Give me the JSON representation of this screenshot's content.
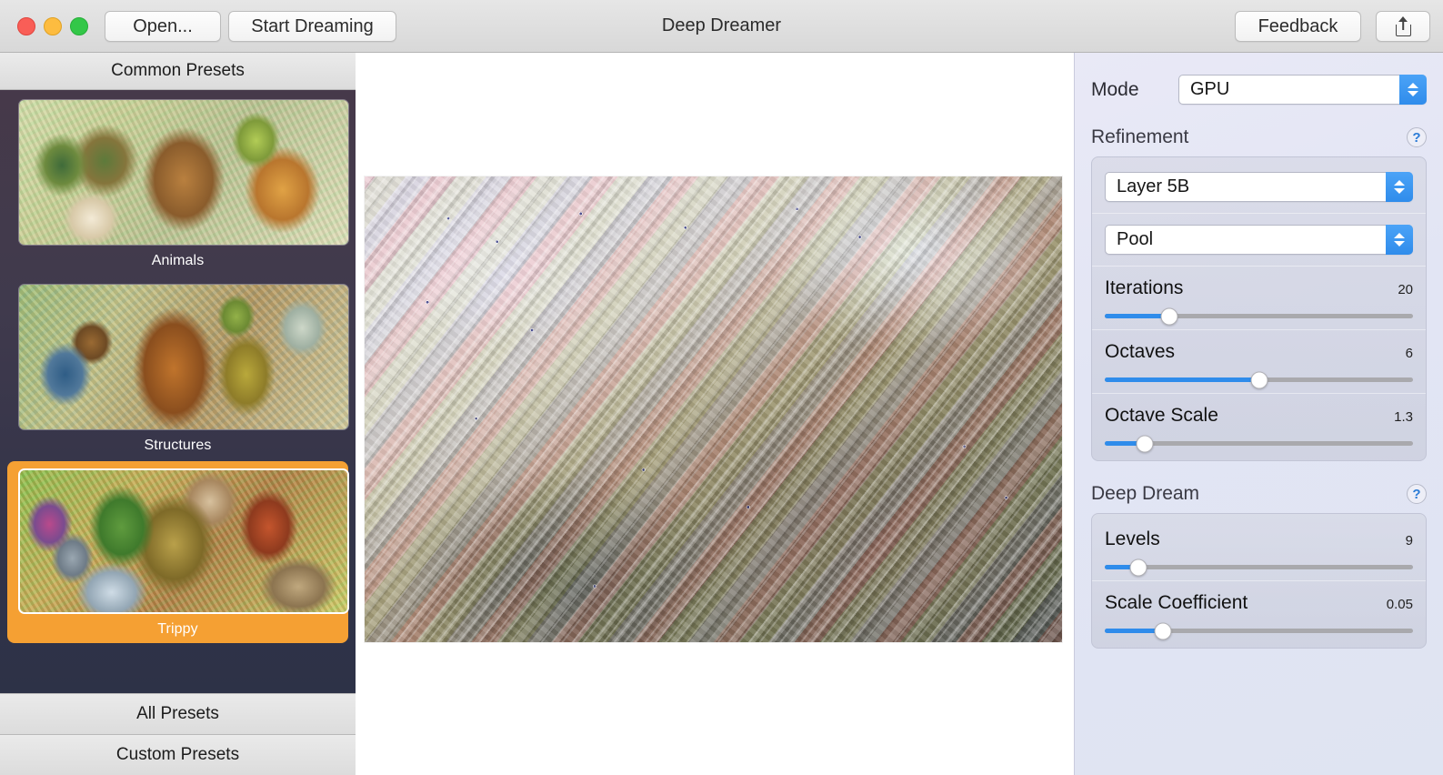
{
  "window": {
    "title": "Deep Dreamer",
    "traffic_lights": [
      {
        "name": "close",
        "color": "#f95e57"
      },
      {
        "name": "minimize",
        "color": "#fdbc40"
      },
      {
        "name": "maximize",
        "color": "#33c748"
      }
    ]
  },
  "toolbar": {
    "open_label": "Open...",
    "start_label": "Start Dreaming",
    "feedback_label": "Feedback",
    "share_icon": "share-icon"
  },
  "sidebar": {
    "header": "Common Presets",
    "accent_selected": "#f5a033",
    "presets": [
      {
        "label": "Animals",
        "selected": false,
        "thumb": "animals-thumbnail"
      },
      {
        "label": "Structures",
        "selected": false,
        "thumb": "structures-thumbnail"
      },
      {
        "label": "Trippy",
        "selected": true,
        "thumb": "trippy-thumbnail"
      }
    ],
    "footer_buttons": [
      {
        "label": "All Presets"
      },
      {
        "label": "Custom Presets"
      }
    ]
  },
  "canvas": {
    "image_name": "deep-dream-output-image"
  },
  "inspector": {
    "mode": {
      "label": "Mode",
      "value": "GPU"
    },
    "refinement": {
      "title": "Refinement",
      "help": "?",
      "layer_select": "Layer 5B",
      "pool_select": "Pool",
      "sliders": [
        {
          "label": "Iterations",
          "value": "20",
          "percent": 21
        },
        {
          "label": "Octaves",
          "value": "6",
          "percent": 50
        },
        {
          "label": "Octave Scale",
          "value": "1.3",
          "percent": 13
        }
      ]
    },
    "deep_dream": {
      "title": "Deep Dream",
      "help": "?",
      "sliders": [
        {
          "label": "Levels",
          "value": "9",
          "percent": 11
        },
        {
          "label": "Scale Coefficient",
          "value": "0.05",
          "percent": 19
        }
      ]
    }
  },
  "colors": {
    "accent_blue": "#2f8ceb",
    "selected_orange": "#f5a033",
    "sidebar_top": "#473949",
    "sidebar_bottom": "#2a3146",
    "inspector_bg": "#e4e8f5"
  }
}
